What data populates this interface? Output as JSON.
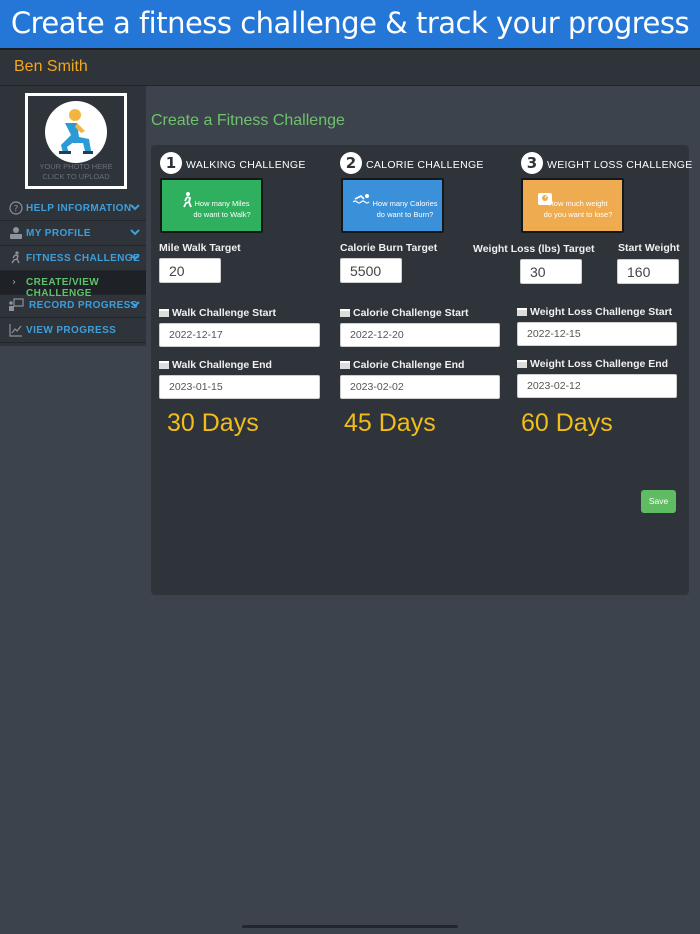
{
  "banner": {
    "title": "Create a fitness challenge & track your progress"
  },
  "user": {
    "name": "Ben Smith"
  },
  "photo": {
    "hint_line1": "YOUR PHOTO HERE",
    "hint_line2": "CLICK TO UPLOAD"
  },
  "sidebar": {
    "items": [
      {
        "label": "HELP INFORMATION",
        "icon": "question-icon"
      },
      {
        "label": "MY PROFILE",
        "icon": "profile-icon"
      },
      {
        "label": "FITNESS CHALLENGE",
        "icon": "running-icon"
      },
      {
        "label": "CREATE/VIEW CHALLENGE",
        "icon": "chevron-right-icon"
      },
      {
        "label": "RECORD PROGRESS",
        "icon": "record-icon"
      },
      {
        "label": "VIEW PROGRESS",
        "icon": "chart-icon"
      }
    ]
  },
  "page": {
    "section_title": "Create a Fitness Challenge"
  },
  "challenges": {
    "walk": {
      "number": "1",
      "title": "WALKING CHALLENGE",
      "card_line1": "How many Miles",
      "card_line2": "do want to Walk?",
      "target_label": "Mile Walk Target",
      "target_value": "20",
      "start_label": "Walk Challenge Start",
      "start_value": "2022-12-17",
      "end_label": "Walk Challenge End",
      "end_value": "2023-01-15",
      "days": "30 Days"
    },
    "calorie": {
      "number": "2",
      "title": "CALORIE CHALLENGE",
      "card_line1": "How many Calories",
      "card_line2": "do want to Burn?",
      "target_label": "Calorie Burn Target",
      "target_value": "5500",
      "start_label": "Calorie Challenge Start",
      "start_value": "2022-12-20",
      "end_label": "Calorie Challenge End",
      "end_value": "2023-02-02",
      "days": "45 Days"
    },
    "weight": {
      "number": "3",
      "title": "WEIGHT LOSS CHALLENGE",
      "card_line1": "How much weight",
      "card_line2": "do you want to lose?",
      "target_label": "Weight Loss (lbs) Target",
      "target_value": "30",
      "start_weight_label": "Start Weight",
      "start_weight_value": "160",
      "start_label": "Weight Loss Challenge Start",
      "start_value": "2022-12-15",
      "end_label": "Weight Loss Challenge End",
      "end_value": "2023-02-12",
      "days": "60 Days"
    }
  },
  "actions": {
    "save_label": "Save"
  },
  "colors": {
    "banner": "#2477d6",
    "accent_orange": "#f3a71c",
    "green": "#2fb05e",
    "blue": "#3a91d9",
    "orange": "#eeab4f",
    "days_yellow": "#f2bd17",
    "save_green": "#5fbc63"
  }
}
